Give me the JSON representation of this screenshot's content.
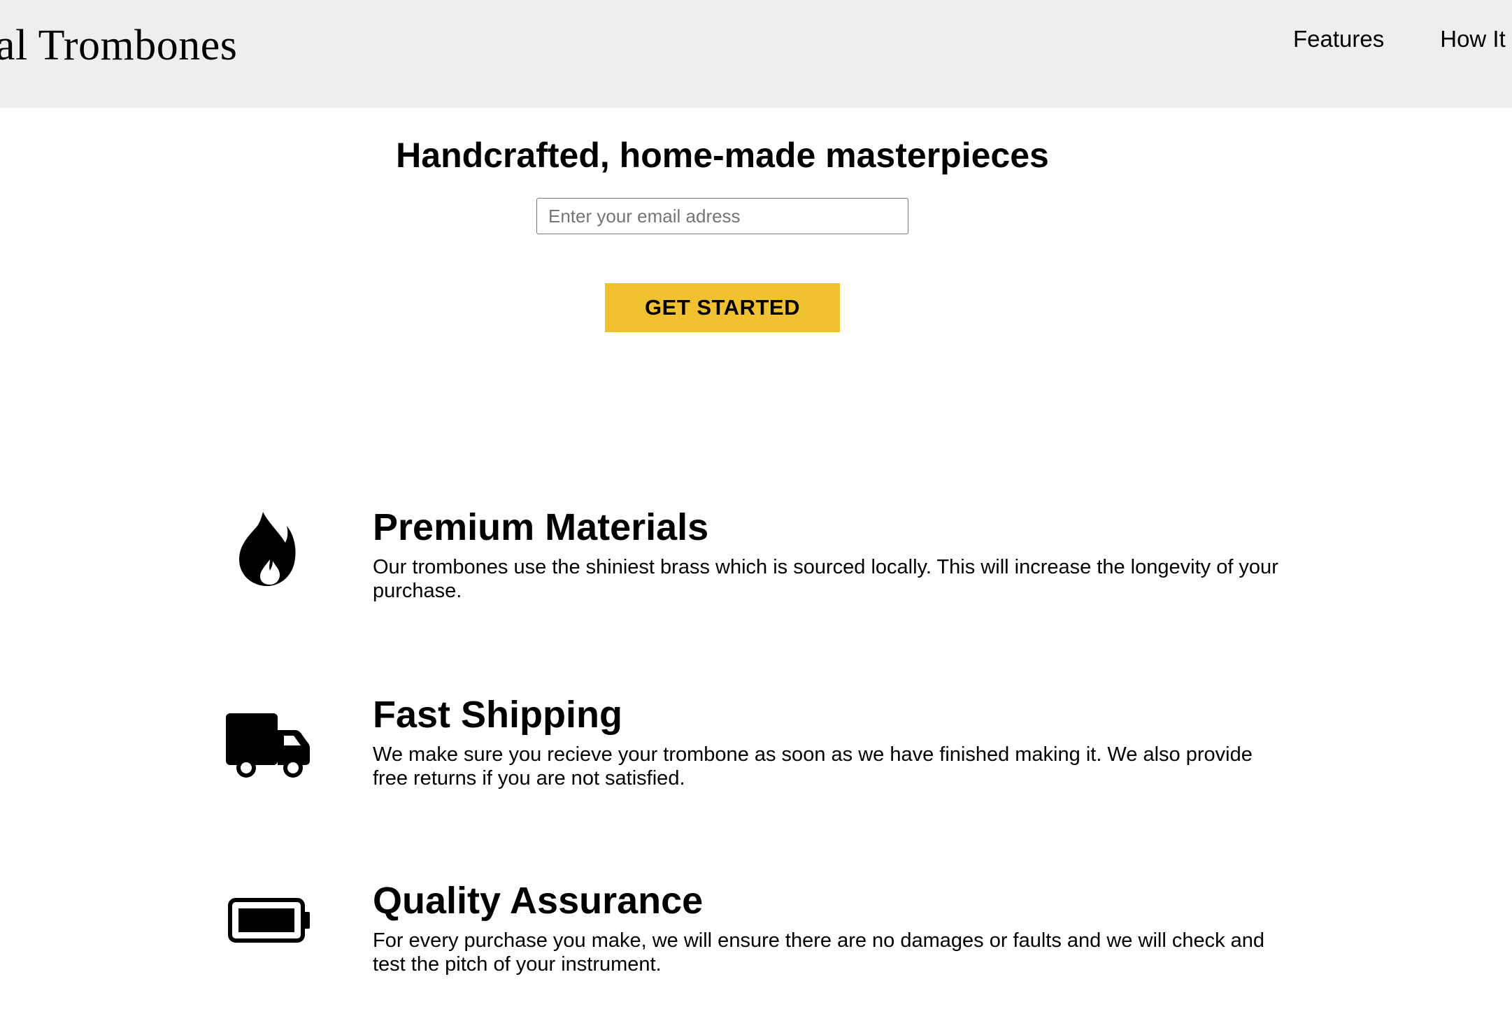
{
  "header": {
    "logo_text": "al Trombones",
    "nav": [
      {
        "label": "Features"
      },
      {
        "label": "How It W"
      }
    ]
  },
  "hero": {
    "title": "Handcrafted, home-made masterpieces",
    "email_placeholder": "Enter your email adress",
    "cta_label": "GET STARTED",
    "cta_color": "#f0c22f"
  },
  "features": [
    {
      "icon": "fire-icon",
      "title": "Premium Materials",
      "description": "Our trombones use the shiniest brass which is sourced locally. This will increase the longevity of your purchase."
    },
    {
      "icon": "truck-icon",
      "title": "Fast Shipping",
      "description": "We make sure you recieve your trombone as soon as we have finished making it. We also provide free returns if you are not satisfied."
    },
    {
      "icon": "battery-full-icon",
      "title": "Quality Assurance",
      "description": "For every purchase you make, we will ensure there are no damages or faults and we will check and test the pitch of your instrument."
    }
  ],
  "colors": {
    "header_background": "#eeeeee",
    "page_background": "#ffffff",
    "text": "#000000"
  }
}
